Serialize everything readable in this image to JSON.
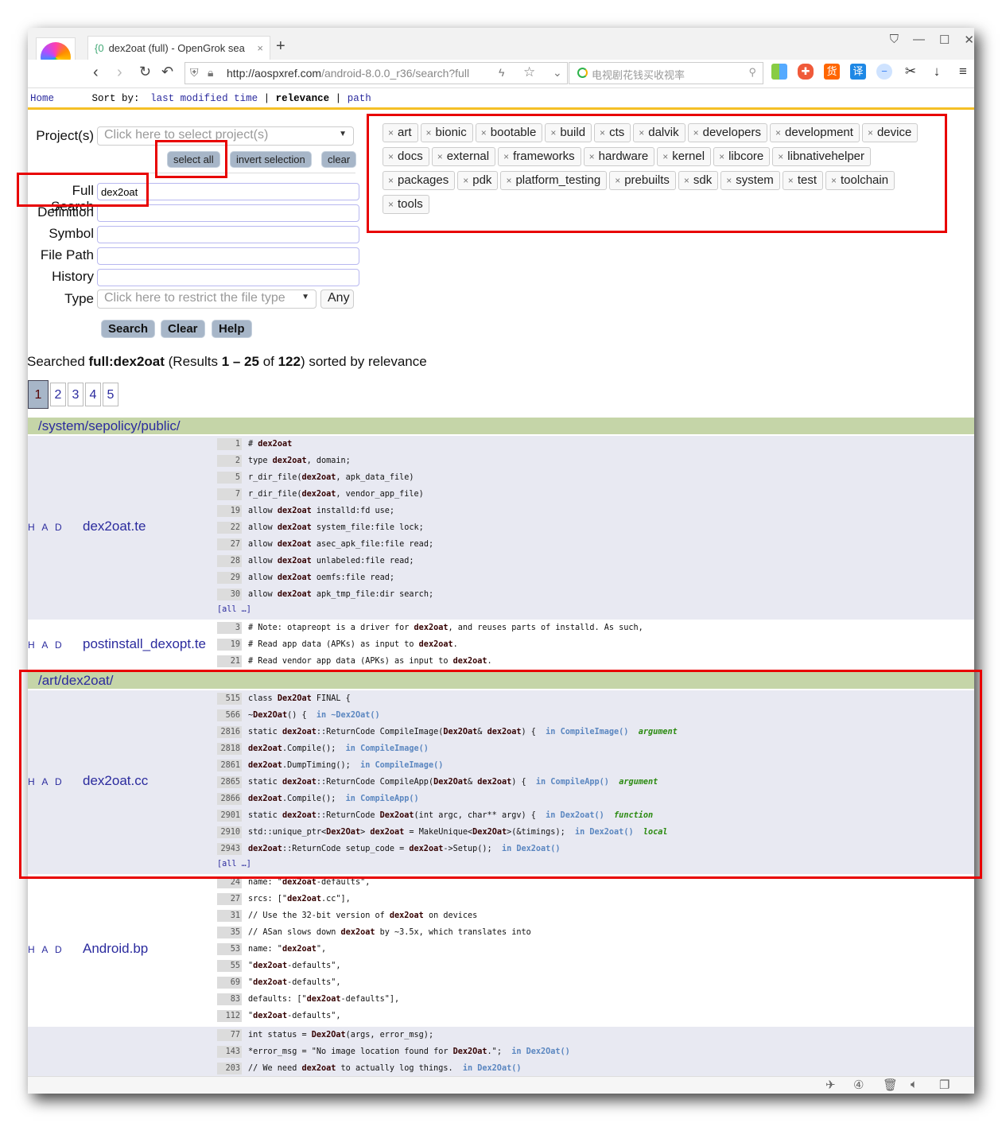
{
  "browser": {
    "tab_title": "dex2oat (full) - OpenGrok sea",
    "url_domain": "http://aospxref.com",
    "url_path": "/android-8.0.0_r36/search?full",
    "search_placeholder": "电视剧花钱买收视率"
  },
  "sortbar": {
    "home": "Home",
    "sort_by": "Sort by:",
    "last_modified": "last modified time",
    "sep": "|",
    "relevance": "relevance",
    "path": "path"
  },
  "form": {
    "projects_label": "Project(s)",
    "projects_placeholder": "Click here to select project(s)",
    "select_all": "select all",
    "invert_selection": "invert selection",
    "clear_small": "clear",
    "full_label": "Full Search",
    "full_value": "dex2oat",
    "definition_label": "Definition",
    "symbol_label": "Symbol",
    "filepath_label": "File Path",
    "history_label": "History",
    "type_label": "Type",
    "type_placeholder": "Click here to restrict the file type",
    "type_any": "Any",
    "search": "Search",
    "clear": "Clear",
    "help": "Help"
  },
  "projects": [
    "art",
    "bionic",
    "bootable",
    "build",
    "cts",
    "dalvik",
    "developers",
    "development",
    "device",
    "docs",
    "external",
    "frameworks",
    "hardware",
    "kernel",
    "libcore",
    "libnativehelper",
    "packages",
    "pdk",
    "platform_testing",
    "prebuilts",
    "sdk",
    "system",
    "test",
    "toolchain",
    "tools"
  ],
  "summary": {
    "p1": "Searched ",
    "query": "full:dex2oat",
    "p2": " (Results ",
    "range": "1 – 25",
    "p3": " of ",
    "total": "122",
    "p4": ") sorted by relevance"
  },
  "pages": [
    "1",
    "2",
    "3",
    "4",
    "5"
  ],
  "had": "H A D",
  "all_link": "[all …]",
  "colors": {
    "accent_bar": "#f5c026",
    "dir_header": "#c5d5a8",
    "row_alt": "#e8e9f2",
    "annotation": "#e80000"
  },
  "results": [
    {
      "dir": "/system/sepolicy/public/",
      "file": "dex2oat.te",
      "gray": true,
      "all": true,
      "lines": [
        [
          "1",
          [
            [
              "# ",
              "n"
            ],
            [
              "dex2oat",
              "b"
            ]
          ]
        ],
        [
          "2",
          [
            [
              "type ",
              "n"
            ],
            [
              "dex2oat",
              "b"
            ],
            [
              ", domain;",
              "n"
            ]
          ]
        ],
        [
          "5",
          [
            [
              "r_dir_file(",
              "n"
            ],
            [
              "dex2oat",
              "b"
            ],
            [
              ", apk_data_file)",
              "n"
            ]
          ]
        ],
        [
          "7",
          [
            [
              "r_dir_file(",
              "n"
            ],
            [
              "dex2oat",
              "b"
            ],
            [
              ", vendor_app_file)",
              "n"
            ]
          ]
        ],
        [
          "19",
          [
            [
              "allow ",
              "n"
            ],
            [
              "dex2oat",
              "b"
            ],
            [
              " installd:fd use;",
              "n"
            ]
          ]
        ],
        [
          "22",
          [
            [
              "allow ",
              "n"
            ],
            [
              "dex2oat",
              "b"
            ],
            [
              " system_file:file lock;",
              "n"
            ]
          ]
        ],
        [
          "27",
          [
            [
              "allow ",
              "n"
            ],
            [
              "dex2oat",
              "b"
            ],
            [
              " asec_apk_file:file read;",
              "n"
            ]
          ]
        ],
        [
          "28",
          [
            [
              "allow ",
              "n"
            ],
            [
              "dex2oat",
              "b"
            ],
            [
              " unlabeled:file read;",
              "n"
            ]
          ]
        ],
        [
          "29",
          [
            [
              "allow ",
              "n"
            ],
            [
              "dex2oat",
              "b"
            ],
            [
              " oemfs:file read;",
              "n"
            ]
          ]
        ],
        [
          "30",
          [
            [
              "allow ",
              "n"
            ],
            [
              "dex2oat",
              "b"
            ],
            [
              " apk_tmp_file:dir search;",
              "n"
            ]
          ]
        ]
      ]
    },
    {
      "file": "postinstall_dexopt.te",
      "gray": false,
      "all": false,
      "lines": [
        [
          "3",
          [
            [
              "# Note: otapreopt is a driver for ",
              "n"
            ],
            [
              "dex2oat",
              "b"
            ],
            [
              ", and reuses parts of installd. As such,",
              "n"
            ]
          ]
        ],
        [
          "19",
          [
            [
              "# Read app data (APKs) as input to ",
              "n"
            ],
            [
              "dex2oat",
              "b"
            ],
            [
              ".",
              "n"
            ]
          ]
        ],
        [
          "21",
          [
            [
              "# Read vendor app data (APKs) as input to ",
              "n"
            ],
            [
              "dex2oat",
              "b"
            ],
            [
              ".",
              "n"
            ]
          ]
        ]
      ]
    },
    {
      "dir": "/art/dex2oat/",
      "file": "dex2oat.cc",
      "gray": true,
      "all": true,
      "lines": [
        [
          "515",
          [
            [
              "class ",
              "n"
            ],
            [
              "Dex2Oat",
              "b"
            ],
            [
              " FINAL {",
              "n"
            ]
          ]
        ],
        [
          "566",
          [
            [
              "~",
              "n"
            ],
            [
              "Dex2Oat",
              "b"
            ],
            [
              "() {  ",
              "n"
            ],
            [
              "in ~Dex2Oat()",
              "s"
            ]
          ]
        ],
        [
          "2816",
          [
            [
              "static ",
              "n"
            ],
            [
              "dex2oat",
              "b"
            ],
            [
              "::ReturnCode CompileImage(",
              "n"
            ],
            [
              "Dex2Oat",
              "b"
            ],
            [
              "& ",
              "n"
            ],
            [
              "dex2oat",
              "b"
            ],
            [
              ") {  ",
              "n"
            ],
            [
              "in CompileImage()",
              "s"
            ],
            [
              "  ",
              "n"
            ],
            [
              "argument",
              "k"
            ]
          ]
        ],
        [
          "2818",
          [
            [
              "dex2oat",
              "b"
            ],
            [
              ".Compile();  ",
              "n"
            ],
            [
              "in CompileImage()",
              "s"
            ]
          ]
        ],
        [
          "2861",
          [
            [
              "dex2oat",
              "b"
            ],
            [
              ".DumpTiming();  ",
              "n"
            ],
            [
              "in CompileImage()",
              "s"
            ]
          ]
        ],
        [
          "2865",
          [
            [
              "static ",
              "n"
            ],
            [
              "dex2oat",
              "b"
            ],
            [
              "::ReturnCode CompileApp(",
              "n"
            ],
            [
              "Dex2Oat",
              "b"
            ],
            [
              "& ",
              "n"
            ],
            [
              "dex2oat",
              "b"
            ],
            [
              ") {  ",
              "n"
            ],
            [
              "in CompileApp()",
              "s"
            ],
            [
              "  ",
              "n"
            ],
            [
              "argument",
              "k"
            ]
          ]
        ],
        [
          "2866",
          [
            [
              "dex2oat",
              "b"
            ],
            [
              ".Compile();  ",
              "n"
            ],
            [
              "in CompileApp()",
              "s"
            ]
          ]
        ],
        [
          "2901",
          [
            [
              "static ",
              "n"
            ],
            [
              "dex2oat",
              "b"
            ],
            [
              "::ReturnCode ",
              "n"
            ],
            [
              "Dex2oat",
              "b"
            ],
            [
              "(int argc, char** argv) {  ",
              "n"
            ],
            [
              "in Dex2oat()",
              "s"
            ],
            [
              "  ",
              "n"
            ],
            [
              "function",
              "k"
            ]
          ]
        ],
        [
          "2910",
          [
            [
              "std::unique_ptr<",
              "n"
            ],
            [
              "Dex2Oat",
              "b"
            ],
            [
              "> ",
              "n"
            ],
            [
              "dex2oat",
              "b"
            ],
            [
              " = MakeUnique<",
              "n"
            ],
            [
              "Dex2Oat",
              "b"
            ],
            [
              ">(&timings);  ",
              "n"
            ],
            [
              "in Dex2oat()",
              "s"
            ],
            [
              "  ",
              "n"
            ],
            [
              "local",
              "k"
            ]
          ]
        ],
        [
          "2943",
          [
            [
              "dex2oat",
              "b"
            ],
            [
              "::ReturnCode setup_code = ",
              "n"
            ],
            [
              "dex2oat",
              "b"
            ],
            [
              "->Setup();  ",
              "n"
            ],
            [
              "in Dex2oat()",
              "s"
            ]
          ]
        ]
      ]
    },
    {
      "file": "Android.bp",
      "gray": false,
      "all": false,
      "lines": [
        [
          "24",
          [
            [
              "name: \"",
              "n"
            ],
            [
              "dex2oat",
              "b"
            ],
            [
              "-defaults\",",
              "n"
            ]
          ]
        ],
        [
          "27",
          [
            [
              "srcs: [\"",
              "n"
            ],
            [
              "dex2oat",
              "b"
            ],
            [
              ".cc\"],",
              "n"
            ]
          ]
        ],
        [
          "31",
          [
            [
              "// Use the 32-bit version of ",
              "n"
            ],
            [
              "dex2oat",
              "b"
            ],
            [
              " on devices",
              "n"
            ]
          ]
        ],
        [
          "35",
          [
            [
              "// ASan slows down ",
              "n"
            ],
            [
              "dex2oat",
              "b"
            ],
            [
              " by ~3.5x, which translates into",
              "n"
            ]
          ]
        ],
        [
          "53",
          [
            [
              "name: \"",
              "n"
            ],
            [
              "dex2oat",
              "b"
            ],
            [
              "\",",
              "n"
            ]
          ]
        ],
        [
          "55",
          [
            [
              "\"",
              "n"
            ],
            [
              "dex2oat",
              "b"
            ],
            [
              "-defaults\",",
              "n"
            ]
          ]
        ],
        [
          "69",
          [
            [
              "\"",
              "n"
            ],
            [
              "dex2oat",
              "b"
            ],
            [
              "-defaults\",",
              "n"
            ]
          ]
        ],
        [
          "83",
          [
            [
              "defaults: [\"",
              "n"
            ],
            [
              "dex2oat",
              "b"
            ],
            [
              "-defaults\"],",
              "n"
            ]
          ]
        ],
        [
          "112",
          [
            [
              "\"",
              "n"
            ],
            [
              "dex2oat",
              "b"
            ],
            [
              "-defaults\",",
              "n"
            ]
          ]
        ]
      ]
    },
    {
      "file": "",
      "gray": true,
      "all": false,
      "lines": [
        [
          "77",
          [
            [
              "int status = ",
              "n"
            ],
            [
              "Dex2Oat",
              "b"
            ],
            [
              "(args, error_msg);",
              "n"
            ]
          ]
        ],
        [
          "143",
          [
            [
              "*error_msg = \"No image location found for ",
              "n"
            ],
            [
              "Dex2Oat",
              "b"
            ],
            [
              ".\";  ",
              "n"
            ],
            [
              "in Dex2Oat()",
              "s"
            ]
          ]
        ],
        [
          "203",
          [
            [
              "// We need ",
              "n"
            ],
            [
              "dex2oat",
              "b"
            ],
            [
              " to actually log things.  ",
              "n"
            ],
            [
              "in Dex2Oat()",
              "s"
            ]
          ]
        ]
      ]
    }
  ]
}
